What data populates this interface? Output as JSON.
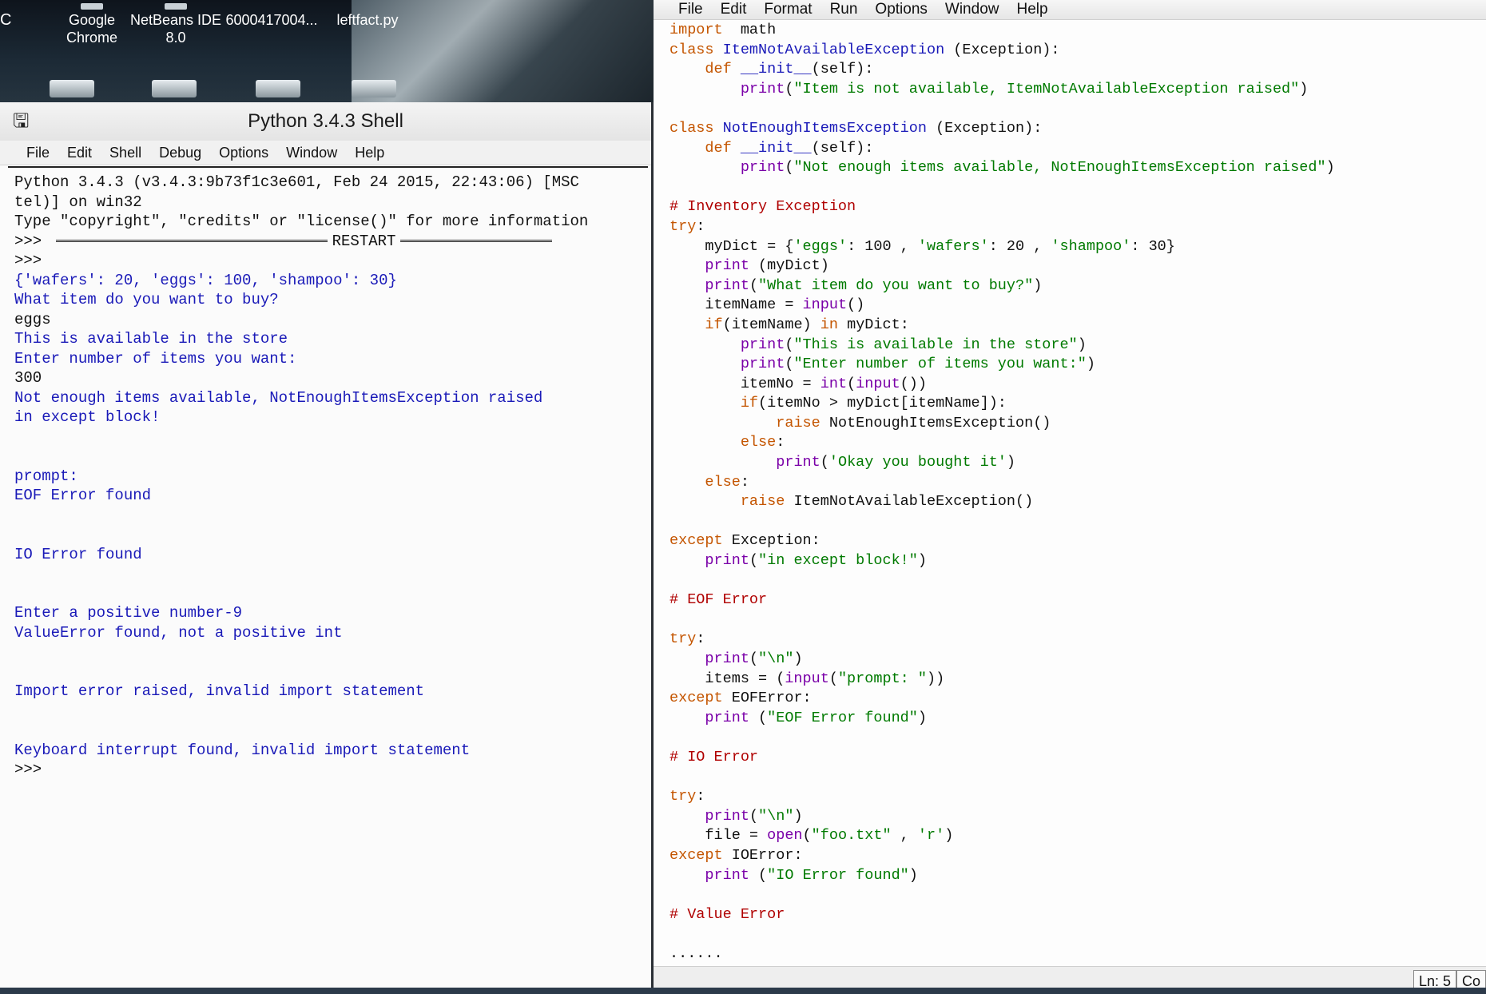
{
  "desktop": {
    "left_edge": "C",
    "icons": [
      {
        "label_line1": "Google",
        "label_line2": "Chrome"
      },
      {
        "label_line1": "NetBeans IDE",
        "label_line2": "8.0"
      },
      {
        "label_line1": "6000417004...",
        "label_line2": ""
      },
      {
        "label_line1": "leftfact.py",
        "label_line2": ""
      }
    ]
  },
  "shell": {
    "title": "Python 3.4.3 Shell",
    "menu": [
      "File",
      "Edit",
      "Shell",
      "Debug",
      "Options",
      "Window",
      "Help"
    ],
    "banner1": "Python 3.4.3 (v3.4.3:9b73f1c3e601, Feb 24 2015, 22:43:06) [MSC",
    "banner2": "tel)] on win32",
    "banner3": "Type \"copyright\", \"credits\" or \"license()\" for more information",
    "restart_prompt": ">>> ",
    "restart_label": "RESTART",
    "prompt": ">>>",
    "out_dict": "{'wafers': 20, 'eggs': 100, 'shampoo': 30}",
    "out_question": "What item do you want to buy?",
    "in_item": "eggs",
    "out_available": "This is available in the store",
    "out_enter": "Enter number of items you want:",
    "in_number": "300",
    "out_not_enough": "Not enough items available, NotEnoughItemsException raised",
    "out_except": "in except block!",
    "out_prompt": "prompt:",
    "out_eof": "EOF Error found",
    "out_io": "IO Error found",
    "out_positive": "Enter a positive number-9",
    "out_value": "ValueError found, not a positive int",
    "out_import": "Import error raised, invalid import statement",
    "out_keyboard": "Keyboard interrupt found, invalid import statement",
    "final_prompt": ">>>"
  },
  "editor": {
    "menu": [
      "File",
      "Edit",
      "Format",
      "Run",
      "Options",
      "Window",
      "Help"
    ],
    "status_line": "Ln: 5",
    "status_col": "Co"
  }
}
